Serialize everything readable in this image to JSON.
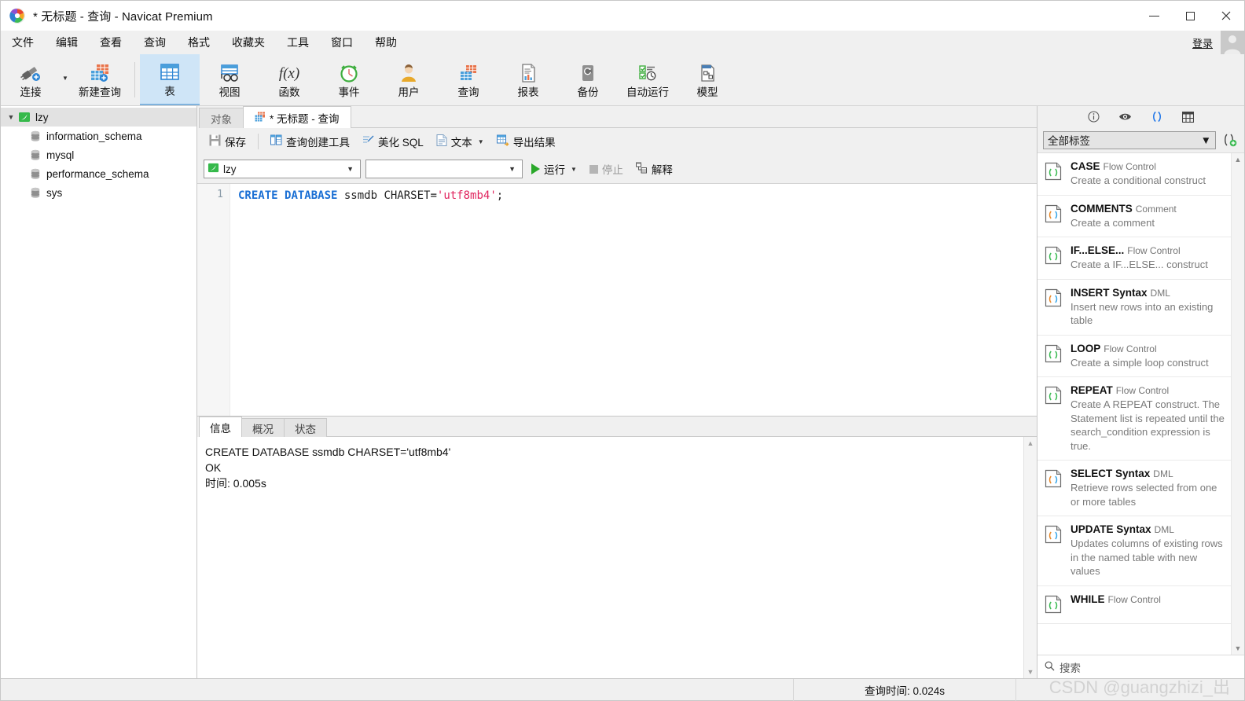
{
  "window": {
    "title": "* 无标题 - 查询 - Navicat Premium",
    "minimize": "—",
    "maximize": "□",
    "close": "✕"
  },
  "menubar": {
    "items": [
      "文件",
      "编辑",
      "查看",
      "查询",
      "格式",
      "收藏夹",
      "工具",
      "窗口",
      "帮助"
    ],
    "login_label": "登录"
  },
  "ribbon": {
    "items": [
      {
        "label": "连接",
        "icon": "connection-icon"
      },
      {
        "label": "新建查询",
        "icon": "new-query-icon"
      },
      {
        "label": "表",
        "icon": "table-icon",
        "selected": true
      },
      {
        "label": "视图",
        "icon": "view-icon"
      },
      {
        "label": "函数",
        "icon": "function-icon"
      },
      {
        "label": "事件",
        "icon": "event-icon"
      },
      {
        "label": "用户",
        "icon": "user-icon"
      },
      {
        "label": "查询",
        "icon": "query-icon"
      },
      {
        "label": "报表",
        "icon": "report-icon"
      },
      {
        "label": "备份",
        "icon": "backup-icon"
      },
      {
        "label": "自动运行",
        "icon": "automation-icon"
      },
      {
        "label": "模型",
        "icon": "model-icon"
      }
    ]
  },
  "sidebar": {
    "connection": "lzy",
    "databases": [
      "information_schema",
      "mysql",
      "performance_schema",
      "sys"
    ]
  },
  "tabs": [
    {
      "label": "对象",
      "active": false
    },
    {
      "label": "* 无标题 - 查询",
      "active": true
    }
  ],
  "query_toolbar": {
    "save": "保存",
    "query_builder": "查询创建工具",
    "beautify_sql": "美化 SQL",
    "text": "文本",
    "export_result": "导出结果"
  },
  "query_controls": {
    "connection_value": "lzy",
    "schema_value": "",
    "run": "运行",
    "stop": "停止",
    "explain": "解释"
  },
  "editor": {
    "line_numbers": [
      "1"
    ],
    "sql_tokens": [
      {
        "t": "CREATE",
        "c": "kw"
      },
      {
        "t": " ",
        "c": "punc"
      },
      {
        "t": "DATABASE",
        "c": "kw"
      },
      {
        "t": " ssmdb CHARSET=",
        "c": "ident"
      },
      {
        "t": "'utf8mb4'",
        "c": "str"
      },
      {
        "t": ";",
        "c": "punc"
      }
    ]
  },
  "results": {
    "tabs": [
      {
        "label": "信息",
        "active": true
      },
      {
        "label": "概况",
        "active": false
      },
      {
        "label": "状态",
        "active": false
      }
    ],
    "message": "CREATE DATABASE ssmdb CHARSET='utf8mb4'\nOK\n时间: 0.005s"
  },
  "right_panel": {
    "icons": [
      {
        "name": "info-icon",
        "glyph": "ⓘ",
        "active": false
      },
      {
        "name": "preview-eye-icon",
        "glyph": "◉",
        "active": false
      },
      {
        "name": "code-snippet-icon",
        "glyph": "()",
        "active": true
      },
      {
        "name": "grid-icon",
        "glyph": "▦",
        "active": false
      }
    ],
    "filter_value": "全部标签",
    "add_snippet_icon": "add-snippet-icon",
    "search_placeholder": "搜索",
    "snippets": [
      {
        "title": "CASE",
        "category": "Flow Control",
        "desc": "Create a conditional construct",
        "icon_variant": "green"
      },
      {
        "title": "COMMENTS",
        "category": "Comment",
        "desc": "Create a comment",
        "icon_variant": "orange"
      },
      {
        "title": "IF...ELSE...",
        "category": "Flow Control",
        "desc": "Create a IF...ELSE... construct",
        "icon_variant": "green"
      },
      {
        "title": "INSERT Syntax",
        "category": "DML",
        "desc": "Insert new rows into an existing table",
        "icon_variant": "orange"
      },
      {
        "title": "LOOP",
        "category": "Flow Control",
        "desc": "Create a simple loop construct",
        "icon_variant": "green"
      },
      {
        "title": "REPEAT",
        "category": "Flow Control",
        "desc": "Create A REPEAT construct. The Statement list is repeated until the search_condition expression is true.",
        "icon_variant": "green"
      },
      {
        "title": "SELECT Syntax",
        "category": "DML",
        "desc": "Retrieve rows selected from one or more tables",
        "icon_variant": "orange"
      },
      {
        "title": "UPDATE Syntax",
        "category": "DML",
        "desc": "Updates columns of existing rows in the named table with new values",
        "icon_variant": "orange"
      },
      {
        "title": "WHILE",
        "category": "Flow Control",
        "desc": "",
        "icon_variant": "green"
      }
    ]
  },
  "statusbar": {
    "query_time": "查询时间: 0.024s"
  },
  "watermark": "CSDN @guangzhizi_出"
}
